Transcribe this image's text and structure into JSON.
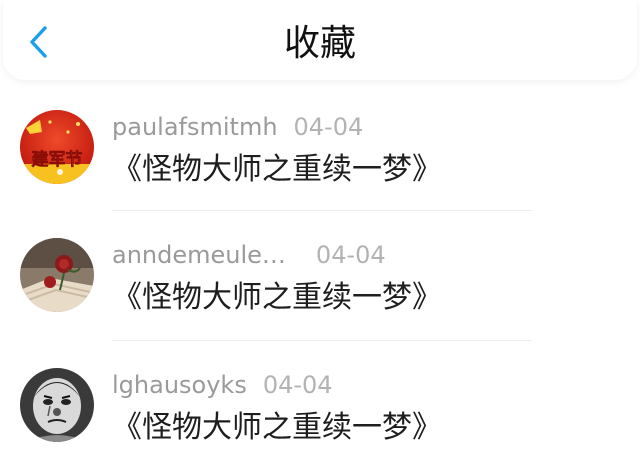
{
  "header": {
    "title": "收藏",
    "back_icon": "chevron-left-icon",
    "accent_color": "#1a9ff0"
  },
  "favorites": [
    {
      "username": "paulafsmitmh",
      "date": "04-04",
      "content": "《怪物大师之重续一梦》",
      "avatar": {
        "icon": "red-festival-avatar",
        "text": "建军节"
      }
    },
    {
      "username": "anndemeule…",
      "date": "04-04",
      "content": "《怪物大师之重续一梦》",
      "avatar": {
        "icon": "rose-book-avatar"
      }
    },
    {
      "username": "lghausoyks",
      "date": "04-04",
      "content": "《怪物大师之重续一梦》",
      "avatar": {
        "icon": "clown-face-avatar"
      }
    }
  ]
}
